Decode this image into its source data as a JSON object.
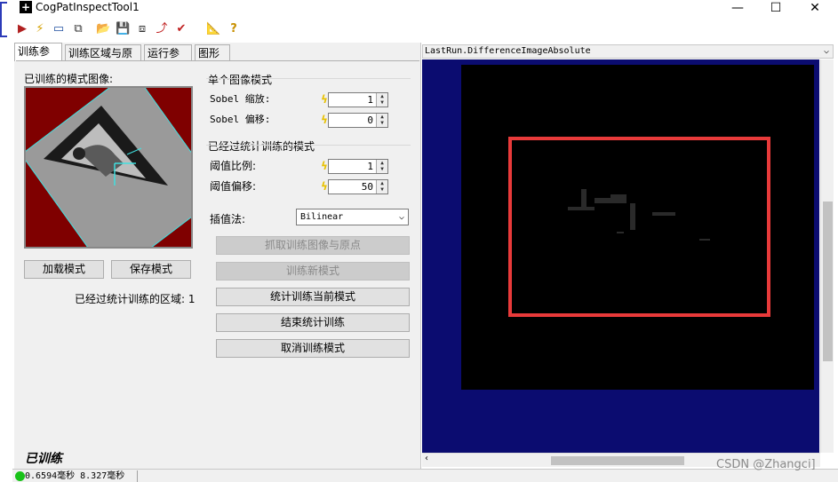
{
  "window": {
    "title": "CogPatInspectTool1",
    "min": "—",
    "max": "☐",
    "close": "✕"
  },
  "toolbar": [
    {
      "icon": "run-icon",
      "glyph": "▶",
      "color": "#b02020"
    },
    {
      "icon": "live-run-icon",
      "glyph": "⚡",
      "color": "#d4a000"
    },
    {
      "icon": "display-icon",
      "glyph": "▭",
      "color": "#2050a0"
    },
    {
      "icon": "copy-icon",
      "glyph": "⧉",
      "color": "#333333"
    },
    {
      "icon": "open-icon",
      "glyph": "📂",
      "color": "#c89000"
    },
    {
      "icon": "save-icon",
      "glyph": "💾",
      "color": "#333333"
    },
    {
      "icon": "save-as-icon",
      "glyph": "⧈",
      "color": "#333333"
    },
    {
      "icon": "reset-icon",
      "glyph": "⤴",
      "color": "#c02020"
    },
    {
      "icon": "state-icon",
      "glyph": "✔",
      "color": "#c02020"
    },
    {
      "icon": "settings-icon",
      "glyph": "📐",
      "color": "#555555"
    },
    {
      "icon": "help-icon",
      "glyph": "?",
      "color": "#c89000"
    }
  ],
  "tabs": [
    "训练参数",
    "训练区域与原点",
    "运行参数",
    "图形"
  ],
  "left": {
    "pattern_label": "已训练的模式图像:",
    "load_button": "加载模式",
    "save_button": "保存模式",
    "trained_regions_label": "已经过统计训练的区域: 1",
    "single_group": "单个图像模式",
    "sobel_scale_label": "Sobel 缩放:",
    "sobel_scale_value": "1",
    "sobel_offset_label": "Sobel 偏移:",
    "sobel_offset_value": "0",
    "stat_group": "已经过统计训练的模式",
    "threshold_scale_label": "阈值比例:",
    "threshold_scale_value": "1",
    "threshold_offset_label": "阈值偏移:",
    "threshold_offset_value": "50",
    "interp_label": "插值法:",
    "interp_value": "Bilinear",
    "grab_button": "抓取训练图像与原点",
    "train_new_button": "训练新模式",
    "stat_train_button": "统计训练当前模式",
    "end_stat_button": "结束统计训练",
    "cancel_train_button": "取消训练模式",
    "trained_status": "已训练"
  },
  "display": {
    "selector": "LastRun.DifferenceImageAbsolute",
    "colors": {
      "background": "#0b0c70",
      "image": "#000000",
      "roi": "#e83a3a"
    }
  },
  "status": {
    "text": "0.6594毫秒 8.327毫秒",
    "indicator_color": "#18c218"
  },
  "watermark": "CSDN @Zhangci]"
}
